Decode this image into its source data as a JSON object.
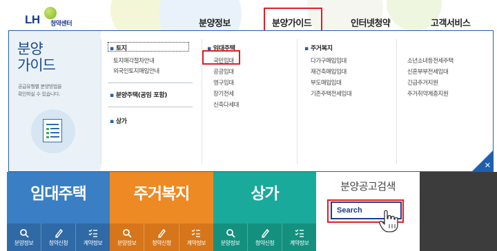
{
  "header": {
    "logo_text": "LH",
    "logo_sub": "청약센터",
    "nav": [
      "분양정보",
      "분양가이드",
      "인터넷청약",
      "고객서비스"
    ],
    "active_nav": "분양가이드"
  },
  "mega_menu": {
    "title": "분양\n가이드",
    "description": "공급유형별 분양방법을\n확인하실 수 있습니다.",
    "columns": [
      {
        "sections": [
          {
            "heading": "토지",
            "items": [
              "토지매각절차안내",
              "외국인토지매입안내"
            ]
          },
          {
            "heading": "분양주택(공임 포함)",
            "items": []
          },
          {
            "heading": "상가",
            "items": []
          }
        ]
      },
      {
        "sections": [
          {
            "heading": "임대주택",
            "items": [
              "국민임대",
              "공공임대",
              "영구임대",
              "장기전세",
              "신축다세대"
            ]
          }
        ]
      },
      {
        "sections": [
          {
            "heading": "주거복지",
            "items": [
              "다가구매입임대",
              "재건축매입임대",
              "부도매입임대",
              "기존주택전세임대"
            ]
          }
        ]
      },
      {
        "sections": [
          {
            "heading": "",
            "items": [
              "소년소녀등전세주택",
              "신혼부부전세임대",
              "긴급주거지원",
              "주거취약계층지원"
            ]
          }
        ]
      }
    ],
    "highlighted_item": "국민임대",
    "close_label": "✕"
  },
  "tiles": [
    {
      "title": "임대주택",
      "color": "#3a7fc4",
      "icons": [
        "분양정보",
        "청약신청",
        "계약정보"
      ]
    },
    {
      "title": "주거복지",
      "color": "#ee8a23",
      "icons": [
        "분양정보",
        "청약신청",
        "계약정보"
      ]
    },
    {
      "title": "상가",
      "color": "#1aaa9c",
      "icons": [
        "분양정보",
        "청약신청",
        "계약정보"
      ]
    }
  ],
  "search_tile": {
    "title": "분양공고검색",
    "button_label": "Search"
  },
  "colors": {
    "accent": "#1f5fb0",
    "highlight": "#e21b24",
    "brand_navy": "#1b3b8e",
    "gray_tile": "#3c3c3c"
  }
}
